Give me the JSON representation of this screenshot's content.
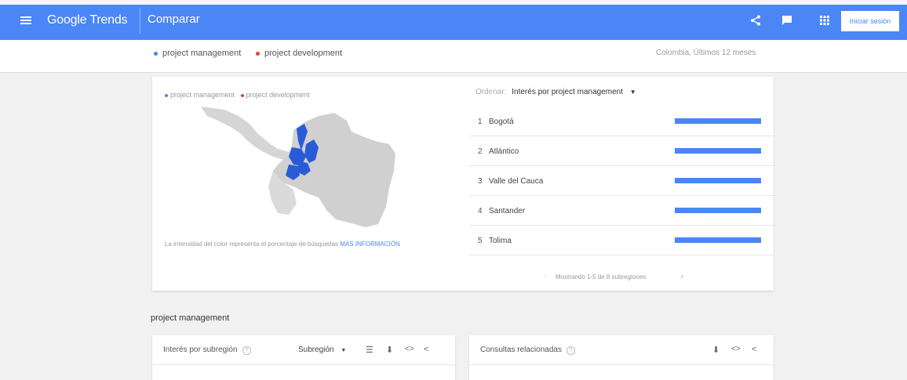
{
  "topbar": {
    "logo": "Google Trends",
    "page_title": "Comparar",
    "signin_label": "Iniciar sesión"
  },
  "compare": {
    "terms": [
      {
        "label": "project management",
        "color": "#4285f4"
      },
      {
        "label": "project development",
        "color": "#db4437"
      }
    ],
    "region": "Colombia, Últimos 12 meses"
  },
  "map_card": {
    "legend": [
      "project management",
      "project development"
    ],
    "note": "La intensidad del color representa el porcentaje de búsquedas",
    "note_link": "MÁS INFORMACIÓN",
    "order_label": "Ordenar:",
    "order_value": "Interés por project management",
    "rankings": [
      {
        "rank": "1",
        "name": "Bogotá",
        "value": 100
      },
      {
        "rank": "2",
        "name": "Atlántico",
        "value": 100
      },
      {
        "rank": "3",
        "name": "Valle del Cauca",
        "value": 100
      },
      {
        "rank": "4",
        "name": "Santander",
        "value": 100
      },
      {
        "rank": "5",
        "name": "Tolima",
        "value": 100
      }
    ],
    "pager": "Mostrando 1-5 de 8 subregiones"
  },
  "section": {
    "title": "project management",
    "left_card": {
      "title": "Interés por subregión",
      "select": "Subregión"
    },
    "right_card": {
      "title": "Consultas relacionadas"
    }
  }
}
